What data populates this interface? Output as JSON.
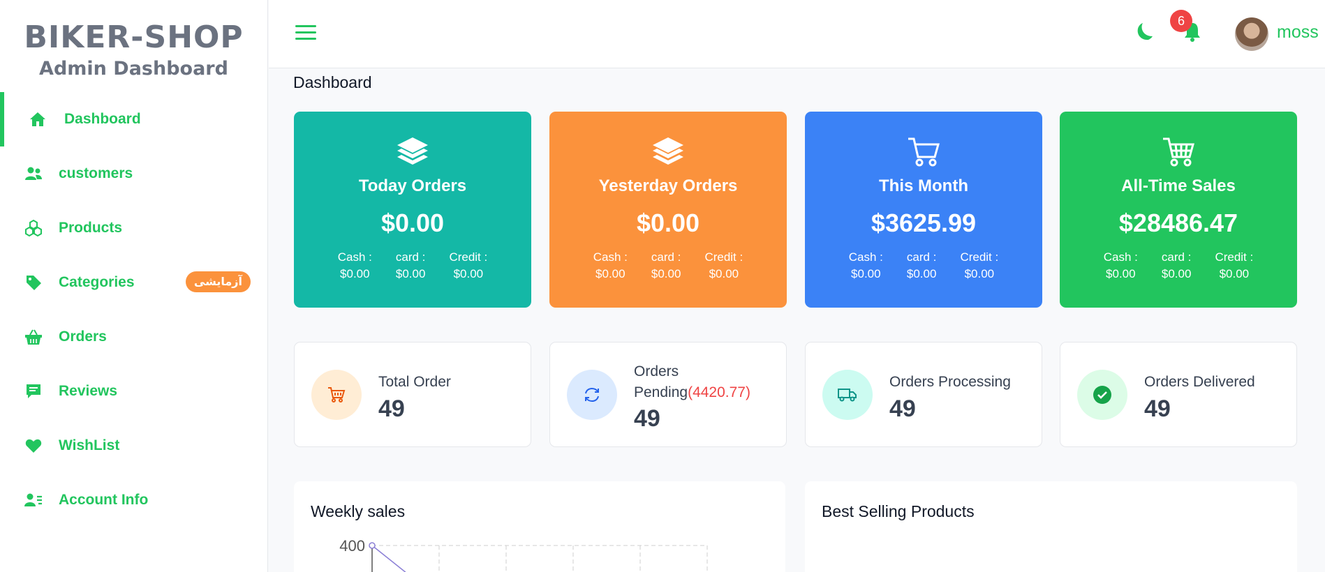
{
  "brand": {
    "title": "BIKER-SHOP",
    "subtitle": "Admin Dashboard"
  },
  "sidebar": {
    "items": [
      {
        "label": "Dashboard",
        "icon": "home-icon",
        "active": true
      },
      {
        "label": "customers",
        "icon": "users-icon"
      },
      {
        "label": "Products",
        "icon": "cubes-icon"
      },
      {
        "label": "Categories",
        "icon": "tag-icon",
        "badge": "آزمایشی"
      },
      {
        "label": "Orders",
        "icon": "basket-icon"
      },
      {
        "label": "Reviews",
        "icon": "comment-icon"
      },
      {
        "label": "WishList",
        "icon": "heart-icon"
      },
      {
        "label": "Account Info",
        "icon": "user-card-icon"
      }
    ]
  },
  "topbar": {
    "notification_count": "6",
    "username": "moss"
  },
  "page_title": "Dashboard",
  "stat_cards": [
    {
      "label": "Today Orders",
      "amount": "$0.00",
      "color": "#14b8a6",
      "icon": "layers-icon",
      "cash_label": "Cash :",
      "cash": "$0.00",
      "card_label": "card :",
      "card": "$0.00",
      "credit_label": "Credit :",
      "credit": "$0.00"
    },
    {
      "label": "Yesterday Orders",
      "amount": "$0.00",
      "color": "#fb923c",
      "icon": "layers-icon",
      "cash_label": "Cash :",
      "cash": "$0.00",
      "card_label": "card :",
      "card": "$0.00",
      "credit_label": "Credit :",
      "credit": "$0.00"
    },
    {
      "label": "This Month",
      "amount": "$3625.99",
      "color": "#3b82f6",
      "icon": "cart-icon",
      "cash_label": "Cash :",
      "cash": "$0.00",
      "card_label": "card :",
      "card": "$0.00",
      "credit_label": "Credit :",
      "credit": "$0.00"
    },
    {
      "label": "All-Time Sales",
      "amount": "$28486.47",
      "color": "#22c55e",
      "icon": "cart-plus-icon",
      "cash_label": "Cash :",
      "cash": "$0.00",
      "card_label": "card :",
      "card": "$0.00",
      "credit_label": "Credit :",
      "credit": "$0.00"
    }
  ],
  "info_cards": [
    {
      "title": "Total Order",
      "value": "49",
      "icon": "cart-icon",
      "bg": "#ffedd5",
      "fg": "#ea580c"
    },
    {
      "title": "Orders",
      "title2": "Pending",
      "extra": "(4420.77)",
      "value": "49",
      "icon": "refresh-icon",
      "bg": "#dbeafe",
      "fg": "#2563eb"
    },
    {
      "title": "Orders Processing",
      "value": "49",
      "icon": "truck-icon",
      "bg": "#ccfbf1",
      "fg": "#0d9488"
    },
    {
      "title": "Orders Delivered",
      "value": "49",
      "icon": "check-icon",
      "bg": "#dcfce7",
      "fg": "#16a34a"
    }
  ],
  "panels": {
    "weekly_sales": "Weekly sales",
    "best_selling": "Best Selling Products"
  },
  "chart_data": {
    "type": "line",
    "title": "Weekly sales",
    "y_tick_labels": [
      "400"
    ],
    "series": [
      {
        "values": [
          400
        ]
      }
    ],
    "grid": true
  }
}
